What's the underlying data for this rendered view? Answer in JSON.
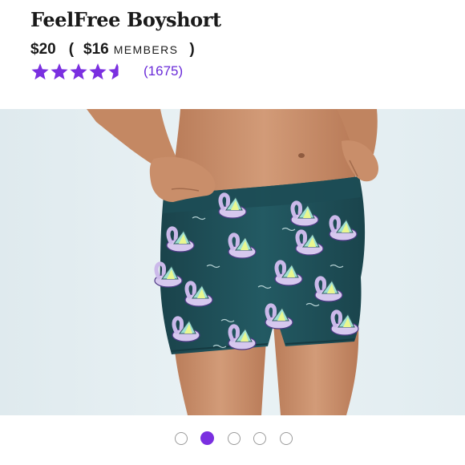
{
  "product": {
    "title": "FeelFree Boyshort",
    "price": "$20",
    "open_paren": "(",
    "member_price": "$16",
    "member_label": "MEMBERS",
    "close_paren": ")",
    "rating": 4.5,
    "rating_max": 5,
    "review_count": "(1675)"
  },
  "gallery": {
    "image_subject": "model-wearing-teal-swan-print-boyshort",
    "image_count": 5,
    "active_index": 1
  },
  "colors": {
    "accent": "#7a2fe0",
    "star": "#7a2fe0",
    "review_count": "#6a2bd8",
    "photo_background": "#e3eef2",
    "garment": "#1f4f58",
    "skin": "#c98e6a"
  },
  "icons": {
    "star": "star-icon",
    "half_star": "star-half-icon",
    "carousel_dot": "carousel-dot-icon"
  }
}
